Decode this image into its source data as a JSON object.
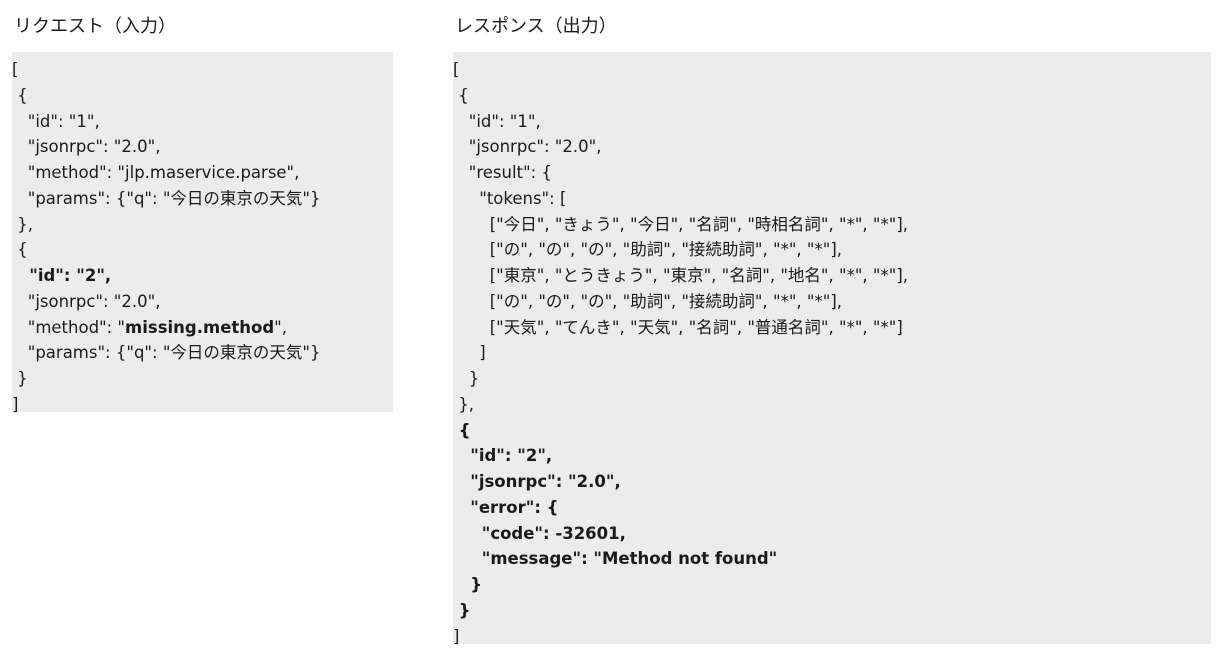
{
  "request": {
    "title": "リクエスト（入力）",
    "lines": [
      [
        {
          "t": "["
        }
      ],
      [
        {
          "t": " {"
        }
      ],
      [
        {
          "t": "   \"id\": \"1\","
        }
      ],
      [
        {
          "t": "   \"jsonrpc\": \"2.0\","
        }
      ],
      [
        {
          "t": "   \"method\": \"jlp.maservice.parse\","
        }
      ],
      [
        {
          "t": "   \"params\": {\"q\": \"今日の東京の天気\"}"
        }
      ],
      [
        {
          "t": " },"
        }
      ],
      [
        {
          "t": " {"
        }
      ],
      [
        {
          "t": "   \"id\": \"2\",",
          "b": true
        }
      ],
      [
        {
          "t": "   \"jsonrpc\": \"2.0\","
        }
      ],
      [
        {
          "t": "   \"method\": \""
        },
        {
          "t": "missing.method",
          "b": true
        },
        {
          "t": "\","
        }
      ],
      [
        {
          "t": "   \"params\": {\"q\": \"今日の東京の天気\"}"
        }
      ],
      [
        {
          "t": " }"
        }
      ],
      [
        {
          "t": "]"
        }
      ]
    ]
  },
  "response": {
    "title": "レスポンス（出力）",
    "lines": [
      [
        {
          "t": "["
        }
      ],
      [
        {
          "t": " {"
        }
      ],
      [
        {
          "t": "   \"id\": \"1\","
        }
      ],
      [
        {
          "t": "   \"jsonrpc\": \"2.0\","
        }
      ],
      [
        {
          "t": "   \"result\": {"
        }
      ],
      [
        {
          "t": "     \"tokens\": ["
        }
      ],
      [
        {
          "t": "       [\"今日\", \"きょう\", \"今日\", \"名詞\", \"時相名詞\", \"*\", \"*\"],"
        }
      ],
      [
        {
          "t": "       [\"の\", \"の\", \"の\", \"助詞\", \"接続助詞\", \"*\", \"*\"],"
        }
      ],
      [
        {
          "t": "       [\"東京\", \"とうきょう\", \"東京\", \"名詞\", \"地名\", \"*\", \"*\"],"
        }
      ],
      [
        {
          "t": "       [\"の\", \"の\", \"の\", \"助詞\", \"接続助詞\", \"*\", \"*\"],"
        }
      ],
      [
        {
          "t": "       [\"天気\", \"てんき\", \"天気\", \"名詞\", \"普通名詞\", \"*\", \"*\"]"
        }
      ],
      [
        {
          "t": "     ]"
        }
      ],
      [
        {
          "t": "   }"
        }
      ],
      [
        {
          "t": " },"
        }
      ],
      [
        {
          "t": " {",
          "b": true
        }
      ],
      [
        {
          "t": "   \"id\": \"2\",",
          "b": true
        }
      ],
      [
        {
          "t": "   \"jsonrpc\": \"2.0\",",
          "b": true
        }
      ],
      [
        {
          "t": "   \"error\": {",
          "b": true
        }
      ],
      [
        {
          "t": "     \"code\": -32601,",
          "b": true
        }
      ],
      [
        {
          "t": "     \"message\": \"Method not found\"",
          "b": true
        }
      ],
      [
        {
          "t": "   }",
          "b": true
        }
      ],
      [
        {
          "t": " }",
          "b": true
        }
      ],
      [
        {
          "t": "]"
        }
      ]
    ]
  }
}
